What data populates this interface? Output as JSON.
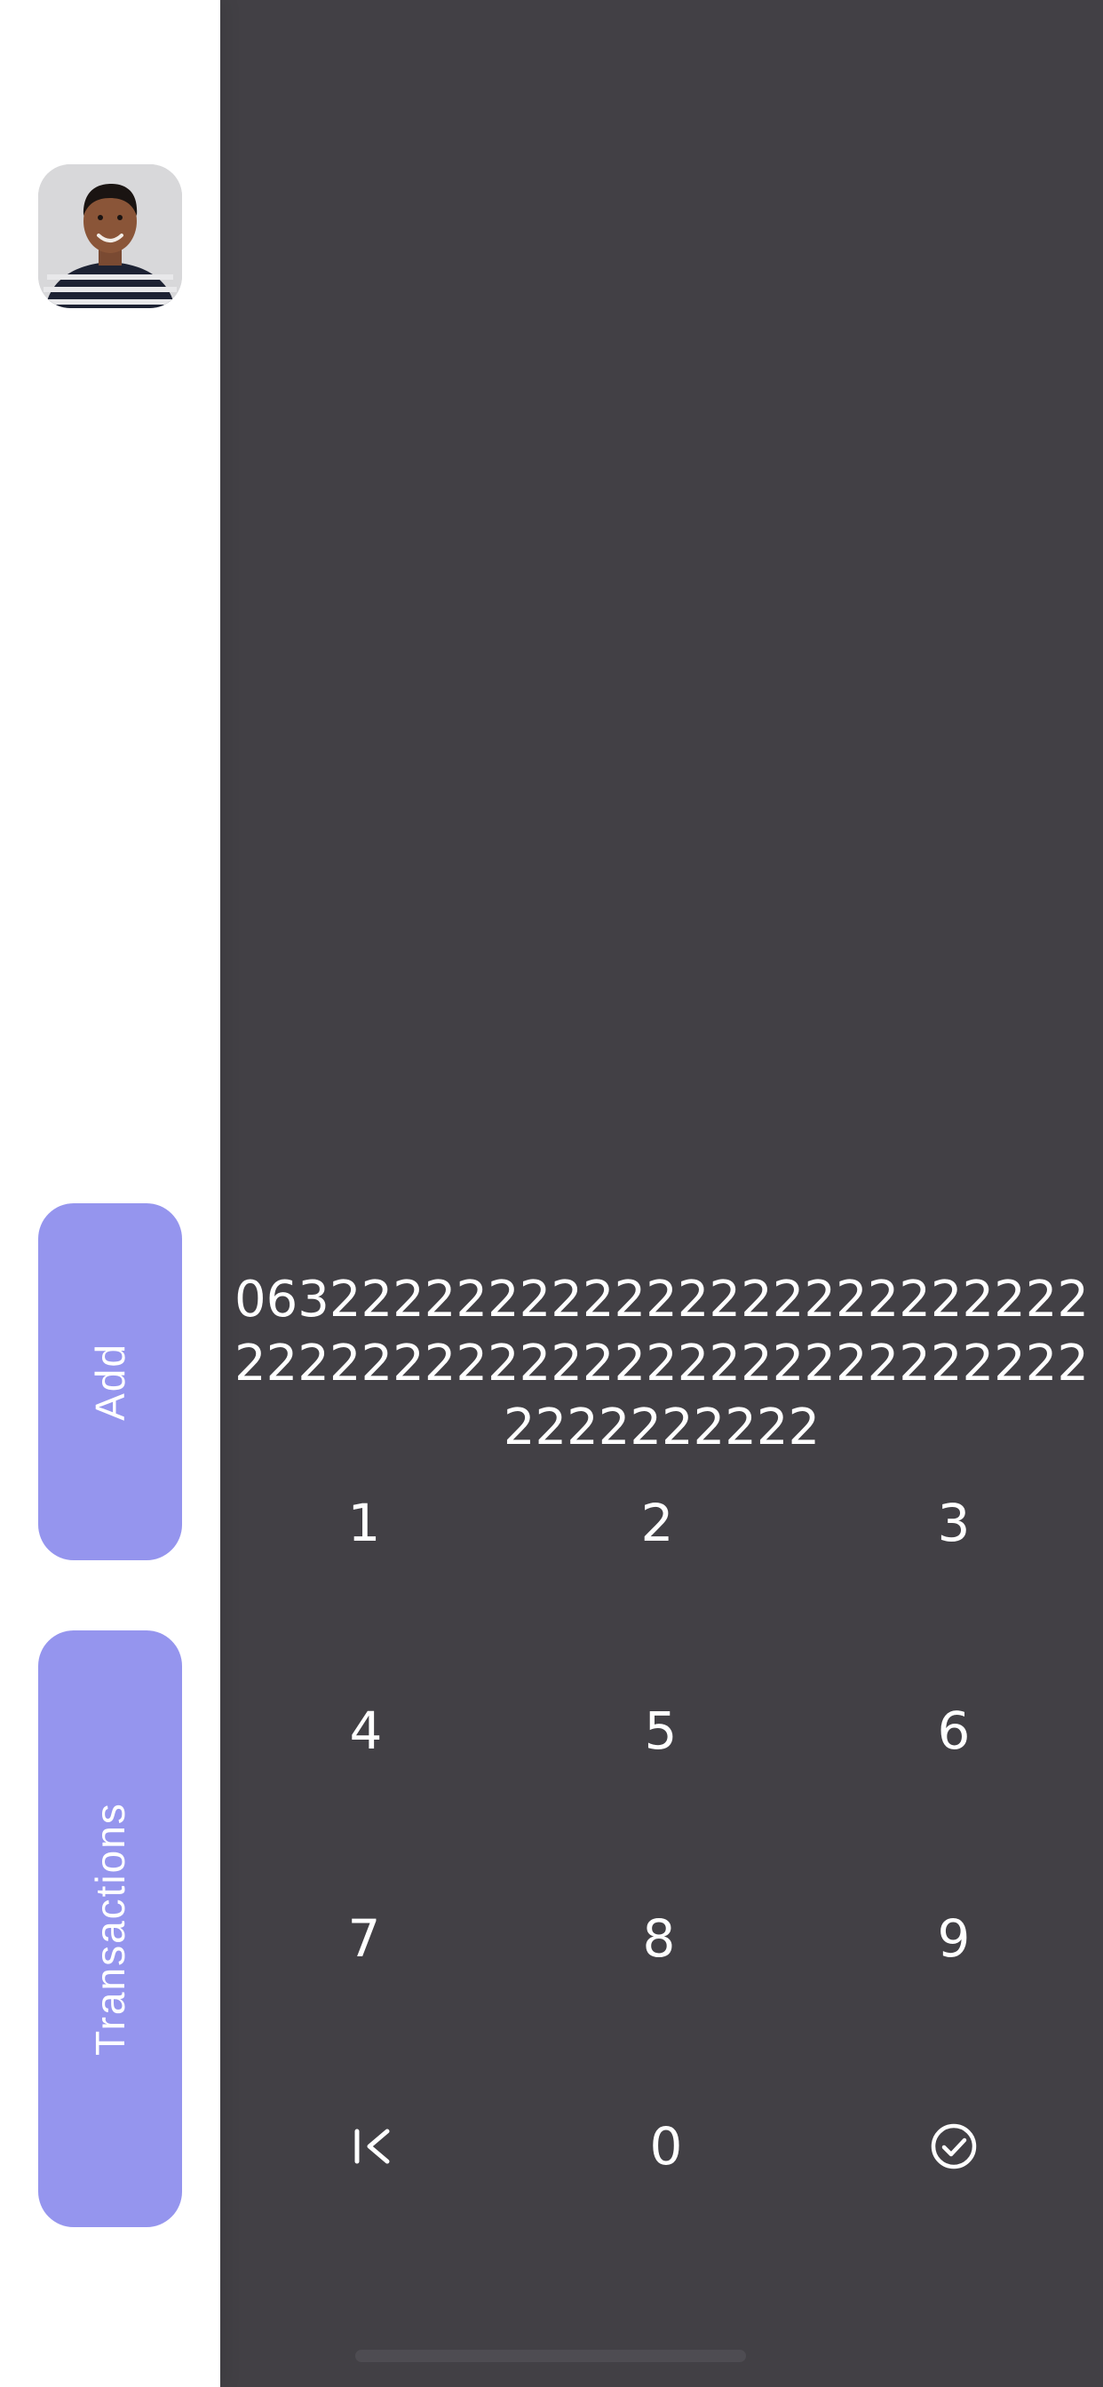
{
  "sidebar": {
    "avatar_alt": "profile photo",
    "add_label": "Add",
    "transactions_label": "Transactions"
  },
  "calculator": {
    "display_value": "0632222222222222222222222222222222222222222222222222222222222222",
    "keys": [
      "1",
      "2",
      "3",
      "4",
      "5",
      "6",
      "7",
      "8",
      "9",
      "0"
    ],
    "backspace_icon": "backspace-icon",
    "confirm_icon": "check-circle-icon"
  },
  "colors": {
    "accent": "#9595ee",
    "panel": "#424045",
    "sidebar": "#ffffff",
    "text": "#ffffff"
  }
}
